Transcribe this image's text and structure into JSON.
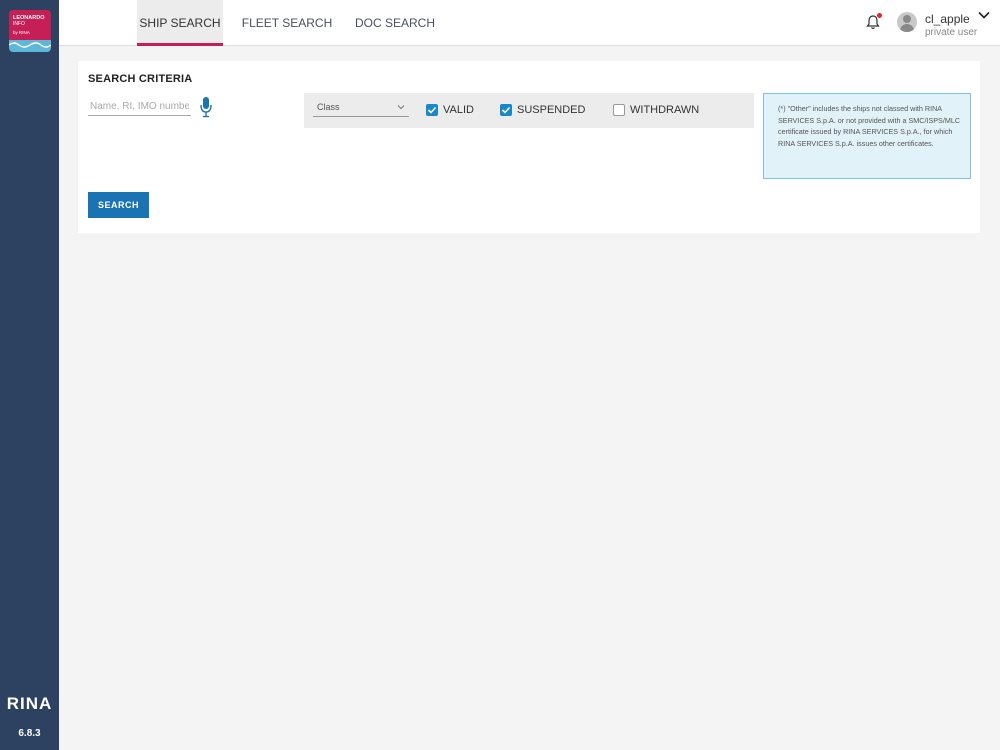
{
  "app": {
    "logo": {
      "line1": "LEONARDO",
      "line2": "INFO",
      "line3": "by RINA"
    },
    "brand": "RINA",
    "version": "6.8.3",
    "colors": {
      "sidebar": "#2d4260",
      "accent": "#c61f58",
      "primary": "#1a74b4",
      "checkbox": "#1a87c9"
    }
  },
  "tabs": [
    {
      "label": "SHIP SEARCH",
      "active": true
    },
    {
      "label": "FLEET SEARCH",
      "active": false
    },
    {
      "label": "DOC SEARCH",
      "active": false
    }
  ],
  "user": {
    "name": "cl_apple",
    "role": "private user",
    "icons": {
      "bell": "bell-icon",
      "avatar": "user-avatar-icon",
      "menu": "chevron-down-icon"
    }
  },
  "search": {
    "title": "SEARCH CRITERIA",
    "placeholder": "Name, RI, IMO number",
    "value": "",
    "class_select": {
      "selected": "Class"
    },
    "checkboxes": [
      {
        "label": "VALID",
        "checked": true
      },
      {
        "label": "SUSPENDED",
        "checked": true
      },
      {
        "label": "WITHDRAWN",
        "checked": false
      }
    ],
    "note": "(*) \"Other\" includes the ships not classed with RINA SERVICES S.p.A. or not provided with a SMC/ISPS/MLC certificate issued by RINA SERVICES S.p.A., for which RINA SERVICES S.p.A. issues other certificates.",
    "button_label": "SEARCH"
  }
}
